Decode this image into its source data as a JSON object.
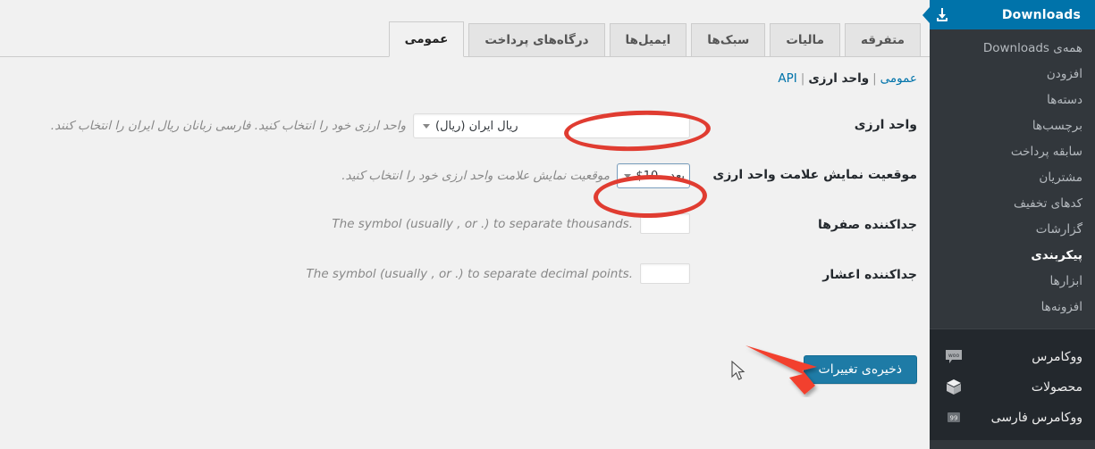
{
  "sidebar": {
    "header": {
      "title": "Downloads",
      "icon": "download-icon"
    },
    "submenu_items": [
      {
        "label": "همه‌ی Downloads",
        "current": false
      },
      {
        "label": "افزودن",
        "current": false
      },
      {
        "label": "دسته‌ها",
        "current": false
      },
      {
        "label": "برچسب‌ها",
        "current": false
      },
      {
        "label": "سابقه پرداخت",
        "current": false
      },
      {
        "label": "مشتریان",
        "current": false
      },
      {
        "label": "کدهای تخفیف",
        "current": false
      },
      {
        "label": "گزارشات",
        "current": false
      },
      {
        "label": "پیکربندی",
        "current": true
      },
      {
        "label": "ابزارها",
        "current": false
      },
      {
        "label": "افزونه‌ها",
        "current": false
      }
    ],
    "top_level_items": [
      {
        "label": "ووکامرس",
        "icon": "woo-bubble-icon"
      },
      {
        "label": "محصولات",
        "icon": "box-icon"
      },
      {
        "label": "ووکامرس فارسی",
        "icon": "persian-99-icon"
      }
    ],
    "colors": {
      "background": "#32373c",
      "header": "#0073aa",
      "group": "#23282d"
    }
  },
  "tabs": [
    {
      "label": "متفرقه",
      "active": false
    },
    {
      "label": "مالیات",
      "active": false
    },
    {
      "label": "سبک‌ها",
      "active": false
    },
    {
      "label": "ایمیل‌ها",
      "active": false
    },
    {
      "label": "درگاه‌های پرداخت",
      "active": false
    },
    {
      "label": "عمومی",
      "active": true
    }
  ],
  "subnav": {
    "items": [
      {
        "label": "عمومی",
        "current": false
      },
      {
        "label": "واحد ارزی",
        "current": true
      },
      {
        "label": "API",
        "current": false
      }
    ],
    "separator": "|"
  },
  "form": {
    "rows": [
      {
        "label": "واحد ارزی",
        "control": "select-wide",
        "value": "ریال ایران (ریال)",
        "description": "واحد ارزی خود را انتخاب کنید. فارسی زبانان ریال ایران را انتخاب کنند.",
        "highlighted": true
      },
      {
        "label": "موقعیت نمایش علامت واحد ارزی",
        "control": "select-small",
        "value": "بعد - 10$",
        "description": "موقعیت نمایش علامت واحد ارزی خود را انتخاب کنید.",
        "highlighted": true
      },
      {
        "label": "جداکننده صفرها",
        "control": "text",
        "value": "",
        "placeholder": "",
        "description": ".The symbol (usually , or .) to separate thousands",
        "highlighted": false
      },
      {
        "label": "جداکننده اعشار",
        "control": "text",
        "value": "",
        "placeholder": "",
        "description": ".The symbol (usually , or .) to separate decimal points",
        "highlighted": false
      }
    ]
  },
  "submit": {
    "label": "ذخیره‌ی تغییرات",
    "color": "#1e7ba6"
  },
  "annotations": {
    "ellipse_color": "#e03c31",
    "arrow_color": "#f2402f",
    "ellipse_currency": "واحد ارزی select highlighted",
    "ellipse_position": "موقعیت نمایش select highlighted",
    "arrow_target": "ذخیره‌ی تغییرات"
  }
}
